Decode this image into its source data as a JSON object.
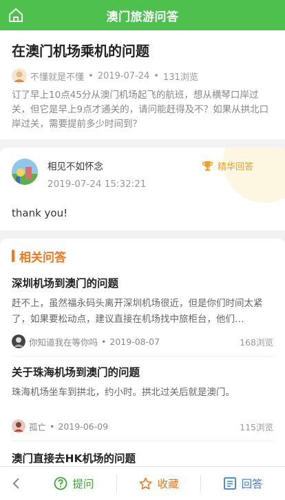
{
  "header": {
    "title": "澳门旅游问答"
  },
  "question": {
    "title": "在澳门机场乘机的问题",
    "author": "不懂就是不懂",
    "date": "2019-07-24",
    "views": "131浏览",
    "body": "订了早上10点45分从澳门机场起飞的航班，想从横琴口岸过关，但它是早上9点才通关的，请问能赶得及不？如果从拱北口岸过关，需要提前多少时间到？"
  },
  "answer": {
    "user": "相见不如怀念",
    "time": "2019-07-24 15:32:21",
    "badge": "精华回答",
    "text": "thank you!"
  },
  "related": {
    "heading": "相关问答",
    "items": [
      {
        "title": "深圳机场到澳门的问题",
        "body": "赶不上，虽然福永码头离开深圳机场很近，但是你们时间太紧了，如果要松动点，建议直接在机场找中旅柜台，他们…",
        "user": "你知道我在等你吗",
        "date": "2019-08-07",
        "views": "168浏览"
      },
      {
        "title": "关于珠海机场到澳门的问题",
        "body": "珠海机场坐车到拱北，约小时。拱北过关后就是澳门。",
        "user": "孤亡",
        "date": "2019-06-09",
        "views": "115浏览"
      },
      {
        "title": "澳门直接去HK机场的问题"
      }
    ]
  },
  "bottom": {
    "ask": "提问",
    "favorite": "收藏",
    "answer": "回答"
  },
  "colors": {
    "green": "#4ec04e",
    "orange": "#f07820",
    "blue": "#3a7bd5",
    "gold": "#f0a020"
  }
}
